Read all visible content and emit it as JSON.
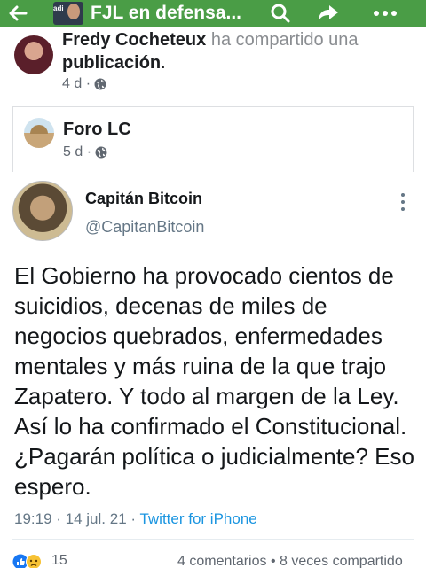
{
  "topbar": {
    "title": "FJL en defensa...",
    "thumb_text": "adi"
  },
  "post": {
    "author": "Fredy Cocheteux",
    "action": " ha compartido una ",
    "object": "publicación",
    "object_suffix": ".",
    "time": "4 d ·"
  },
  "shared": {
    "page_name": "Foro LC",
    "time": "5 d ·"
  },
  "tweet": {
    "name": "Capitán Bitcoin",
    "handle": "@CapitanBitcoin",
    "text": "El Gobierno ha provocado cientos de suicidios, decenas de miles de negocios quebrados, enfermedades mentales y más ruina de la que trajo Zapatero. Y todo al margen de la Ley. Así lo ha confirmado el Constitucional. ¿Pagarán política o judicialmente? Eso espero.",
    "timestamp": "19:19 · 14 jul. 21 · ",
    "source": "Twitter for iPhone"
  },
  "reactions": {
    "count": "15",
    "summary": "4 comentarios • 8 veces compartido"
  },
  "colors": {
    "appbar": "#4a9d46",
    "link": "#1b95e0",
    "muted": "#657786"
  },
  "icons": [
    "back-arrow-icon",
    "search-icon",
    "share-icon",
    "more-icon",
    "globe-icon",
    "kebab-icon",
    "like-icon",
    "sad-icon"
  ]
}
